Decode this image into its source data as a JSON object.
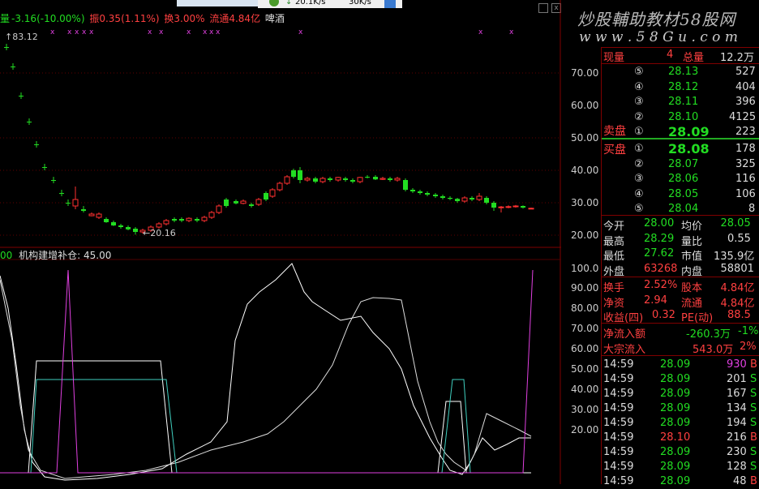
{
  "toolbar": {
    "download_speed": "20.1K/s",
    "upload_speed": "30K/s"
  },
  "watermark": {
    "line1": "炒股輔助教材58股网",
    "line2": "w w w . 5 8 G u . c o m"
  },
  "stock_header": {
    "prefix": "量",
    "change": "-3.16(-10.00%)",
    "amplitude": "振0.35(1.11%)",
    "turnover": "换3.00%",
    "float_cap": "流通4.84亿",
    "name": "啤酒",
    "high_marker": "83.12",
    "low_marker": "20.16"
  },
  "price_axis": [
    "70.00",
    "60.00",
    "50.00",
    "40.00",
    "30.00",
    "20.00"
  ],
  "indicator": {
    "left_value": "00",
    "name": "机构建增补仓",
    "value": "45.00",
    "axis": [
      "100.0",
      "90.00",
      "80.00",
      "70.00",
      "60.00",
      "50.00",
      "40.00",
      "30.00",
      "20.00"
    ]
  },
  "quote": {
    "current_vol_label": "现量",
    "current_vol": "4",
    "total_vol_label": "总量",
    "total_vol": "12.2万",
    "sell_label": "卖盘",
    "buy_label": "买盘",
    "asks": [
      {
        "level": "⑤",
        "price": "28.13",
        "vol": "527"
      },
      {
        "level": "④",
        "price": "28.12",
        "vol": "404"
      },
      {
        "level": "③",
        "price": "28.11",
        "vol": "396"
      },
      {
        "level": "②",
        "price": "28.10",
        "vol": "4125"
      },
      {
        "level": "①",
        "price": "28.09",
        "vol": "223"
      }
    ],
    "bids": [
      {
        "level": "①",
        "price": "28.08",
        "vol": "178"
      },
      {
        "level": "②",
        "price": "28.07",
        "vol": "325"
      },
      {
        "level": "③",
        "price": "28.06",
        "vol": "116"
      },
      {
        "level": "④",
        "price": "28.05",
        "vol": "106"
      },
      {
        "level": "⑤",
        "price": "28.04",
        "vol": "8"
      }
    ],
    "stats": [
      {
        "l1": "今开",
        "v1": "28.00",
        "l2": "均价",
        "v2": "28.05"
      },
      {
        "l1": "最高",
        "v1": "28.29",
        "l2": "量比",
        "v2": "0.55"
      },
      {
        "l1": "最低",
        "v1": "27.62",
        "l2": "市值",
        "v2": "135.9亿"
      },
      {
        "l1": "外盘",
        "v1": "63268",
        "l2": "内盘",
        "v2": "58801"
      }
    ],
    "stats2": [
      {
        "l1": "换手",
        "v1": "2.52%",
        "l2": "股本",
        "v2": "4.84亿"
      },
      {
        "l1": "净资",
        "v1": "2.94",
        "l2": "流通",
        "v2": "4.84亿"
      },
      {
        "l1": "收益(四)",
        "v1": "0.32",
        "l2": "PE(动)",
        "v2": "88.5"
      }
    ],
    "netflow_label": "净流入额",
    "netflow_value": "-260.3万",
    "netflow_pct": "-1%",
    "block_label": "大宗流入",
    "block_value": "543.0万",
    "block_pct": "2%"
  },
  "ticks": [
    {
      "time": "14:59",
      "price": "28.09",
      "vol": "930",
      "side": "B"
    },
    {
      "time": "14:59",
      "price": "28.09",
      "vol": "201",
      "side": "S"
    },
    {
      "time": "14:59",
      "price": "28.09",
      "vol": "167",
      "side": "S"
    },
    {
      "time": "14:59",
      "price": "28.09",
      "vol": "134",
      "side": "S"
    },
    {
      "time": "14:59",
      "price": "28.09",
      "vol": "194",
      "side": "S"
    },
    {
      "time": "14:59",
      "price": "28.10",
      "vol": "216",
      "side": "B"
    },
    {
      "time": "14:59",
      "price": "28.09",
      "vol": "230",
      "side": "S"
    },
    {
      "time": "14:59",
      "price": "28.09",
      "vol": "128",
      "side": "S"
    },
    {
      "time": "14:59",
      "price": "28.09",
      "vol": "48",
      "side": "B"
    }
  ]
}
